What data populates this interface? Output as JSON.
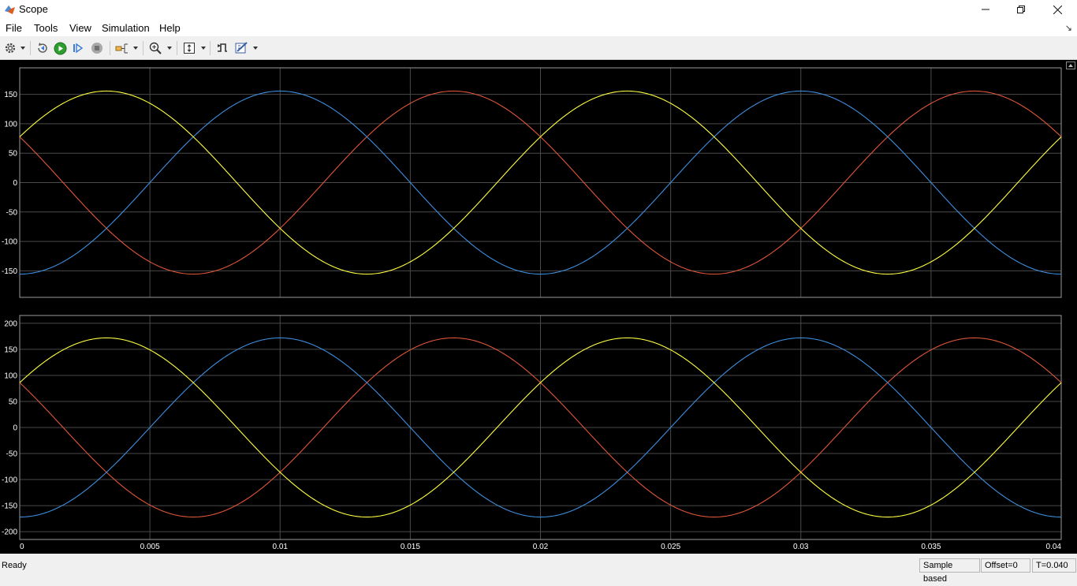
{
  "window": {
    "title": "Scope"
  },
  "menu": [
    "File",
    "Tools",
    "View",
    "Simulation",
    "Help"
  ],
  "toolbar_icons": [
    "configuration-gear-icon",
    "step-back-icon",
    "run-icon",
    "step-forward-icon",
    "stop-icon",
    "signal-select-icon",
    "zoom-in-icon",
    "autoscale-icon",
    "triggers-icon",
    "measurements-icon"
  ],
  "colors": {
    "plot_bg": "#000000",
    "grid": "#4a4a4a",
    "axis_text": "#ffffff",
    "phase_a": "#ffff40",
    "phase_b": "#3d8fe0",
    "phase_c": "#e0563a"
  },
  "chart_data": [
    {
      "type": "line",
      "title": "",
      "xlabel": "",
      "ylabel": "",
      "xlim": [
        0,
        0.04
      ],
      "ylim": [
        -195,
        195
      ],
      "yticks": [
        150,
        100,
        50,
        0,
        -50,
        -100,
        -150
      ],
      "xticks": [
        0,
        0.005,
        0.01,
        0.015,
        0.02,
        0.025,
        0.03,
        0.035,
        0.04
      ],
      "grid": true,
      "series_formula": "y = amplitude * sin(2*pi*frequency*t + phase_deg)",
      "frequency": 50,
      "series": [
        {
          "amplitude": 155.5,
          "phase_deg": 30,
          "color": "#ffff40"
        },
        {
          "amplitude": 155.5,
          "phase_deg": -90,
          "color": "#3d8fe0"
        },
        {
          "amplitude": 155.5,
          "phase_deg": 150,
          "color": "#e0563a"
        }
      ]
    },
    {
      "type": "line",
      "title": "",
      "xlabel": "",
      "ylabel": "",
      "xlim": [
        0,
        0.04
      ],
      "ylim": [
        -215,
        215
      ],
      "yticks": [
        200,
        150,
        100,
        50,
        0,
        -50,
        -100,
        -150,
        -200
      ],
      "xticks": [
        0,
        0.005,
        0.01,
        0.015,
        0.02,
        0.025,
        0.03,
        0.035,
        0.04
      ],
      "xtick_labels": [
        "0",
        "0.005",
        "0.01",
        "0.015",
        "0.02",
        "0.025",
        "0.03",
        "0.035",
        "0.04"
      ],
      "grid": true,
      "series_formula": "y = amplitude * sin(2*pi*frequency*t + phase_deg)",
      "frequency": 50,
      "series": [
        {
          "amplitude": 172,
          "phase_deg": 30,
          "color": "#ffff40"
        },
        {
          "amplitude": 172,
          "phase_deg": -90,
          "color": "#3d8fe0"
        },
        {
          "amplitude": 172,
          "phase_deg": 150,
          "color": "#e0563a"
        }
      ]
    }
  ],
  "status": {
    "left": "Ready",
    "mode": "Sample based",
    "offset": "Offset=0",
    "time": "T=0.040"
  }
}
